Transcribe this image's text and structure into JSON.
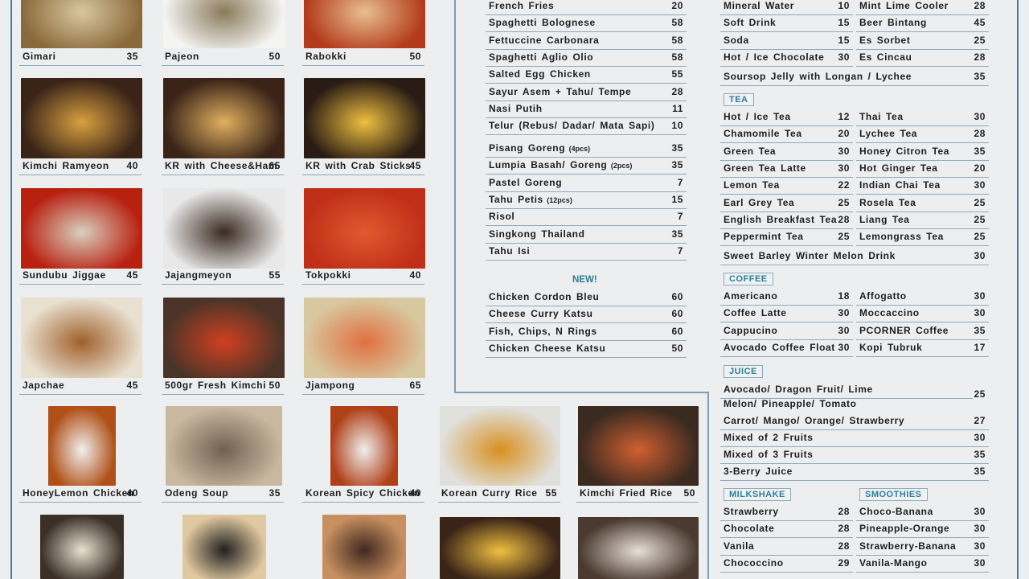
{
  "photo_items": [
    {
      "name": "Gimari",
      "price": "35"
    },
    {
      "name": "Pajeon",
      "price": "50"
    },
    {
      "name": "Rabokki",
      "price": "50"
    },
    {
      "name": "Kimchi Ramyeon",
      "price": "40"
    },
    {
      "name": "KR with Cheese&Ham",
      "price": "65"
    },
    {
      "name": "KR with Crab Sticks",
      "price": "45"
    },
    {
      "name": "Sundubu Jiggae",
      "price": "45"
    },
    {
      "name": "Jajangmeyon",
      "price": "55"
    },
    {
      "name": "Tokpokki",
      "price": "40"
    },
    {
      "name": "Japchae",
      "price": "45"
    },
    {
      "name": "500gr Fresh Kimchi",
      "price": "50"
    },
    {
      "name": "Jjampong",
      "price": "65"
    },
    {
      "name": "HoneyLemon Chicken",
      "price": "40"
    },
    {
      "name": "Odeng Soup",
      "price": "35"
    },
    {
      "name": "Korean Spicy Chicken",
      "price": "40"
    },
    {
      "name": "Korean Curry Rice",
      "price": "55"
    },
    {
      "name": "Kimchi Fried Rice",
      "price": "50"
    }
  ],
  "main_menu": [
    {
      "name": "French Fries",
      "price": "20"
    },
    {
      "name": "Spaghetti Bolognese",
      "price": "58"
    },
    {
      "name": "Fettuccine Carbonara",
      "price": "58"
    },
    {
      "name": "Spaghetti Aglio Olio",
      "price": "58"
    },
    {
      "name": "Salted Egg Chicken",
      "price": "55"
    },
    {
      "name": "Sayur Asem + Tahu/ Tempe",
      "price": "28"
    },
    {
      "name": "Nasi Putih",
      "price": "11"
    },
    {
      "name": "Telur (Rebus/ Dadar/ Mata Sapi)",
      "price": "10"
    }
  ],
  "snacks": [
    {
      "name": "Pisang Goreng",
      "note": "(4pcs)",
      "price": "35"
    },
    {
      "name": "Lumpia Basah/ Goreng",
      "note": "(2pcs)",
      "price": "35"
    },
    {
      "name": "Pastel Goreng",
      "price": "7"
    },
    {
      "name": "Tahu Petis",
      "note": "(12pcs)",
      "price": "15"
    },
    {
      "name": "Risol",
      "price": "7"
    },
    {
      "name": "Singkong Thailand",
      "price": "35"
    },
    {
      "name": "Tahu Isi",
      "price": "7"
    }
  ],
  "new_section": {
    "label": "NEW!",
    "items": [
      {
        "name": "Chicken Cordon Bleu",
        "price": "60"
      },
      {
        "name": "Cheese Curry Katsu",
        "price": "60"
      },
      {
        "name": "Fish, Chips, N Rings",
        "price": "60"
      },
      {
        "name": "Chicken Cheese Katsu",
        "price": "50"
      }
    ]
  },
  "drinks": {
    "left": [
      {
        "name": "Mineral Water",
        "price": "10"
      },
      {
        "name": "Soft Drink",
        "price": "15"
      },
      {
        "name": "Soda",
        "price": "15"
      },
      {
        "name": "Hot / Ice Chocolate",
        "price": "30"
      }
    ],
    "right": [
      {
        "name": "Mint Lime Cooler",
        "price": "28"
      },
      {
        "name": "Beer Bintang",
        "price": "45"
      },
      {
        "name": "Es Sorbet",
        "price": "25"
      },
      {
        "name": "Es Cincau",
        "price": "28"
      }
    ],
    "wide": {
      "name": "Soursop Jelly with Longan / Lychee",
      "price": "35"
    }
  },
  "tea": {
    "label": "TEA",
    "left": [
      {
        "name": "Hot / Ice Tea",
        "price": "12"
      },
      {
        "name": "Chamomile Tea",
        "price": "20"
      },
      {
        "name": "Green Tea",
        "price": "30"
      },
      {
        "name": "Green Tea Latte",
        "price": "30"
      },
      {
        "name": "Lemon Tea",
        "price": "22"
      },
      {
        "name": "Earl Grey Tea",
        "price": "25"
      },
      {
        "name": "English Breakfast Tea",
        "price": "28"
      },
      {
        "name": "Peppermint Tea",
        "price": "25"
      }
    ],
    "right": [
      {
        "name": "Thai Tea",
        "price": "30"
      },
      {
        "name": "Lychee Tea",
        "price": "28"
      },
      {
        "name": "Honey Citron Tea",
        "price": "35"
      },
      {
        "name": "Hot Ginger Tea",
        "price": "20"
      },
      {
        "name": "Indian Chai Tea",
        "price": "30"
      },
      {
        "name": "Rosela Tea",
        "price": "25"
      },
      {
        "name": "Liang Tea",
        "price": "25"
      },
      {
        "name": "Lemongrass Tea",
        "price": "25"
      }
    ],
    "wide": {
      "name": "Sweet Barley Winter Melon Drink",
      "price": "30"
    }
  },
  "coffee": {
    "label": "COFFEE",
    "left": [
      {
        "name": "Americano",
        "price": "18"
      },
      {
        "name": "Coffee Latte",
        "price": "30"
      },
      {
        "name": "Cappucino",
        "price": "30"
      },
      {
        "name": "Avocado Coffee Float",
        "price": "30"
      }
    ],
    "right": [
      {
        "name": "Affogatto",
        "price": "30"
      },
      {
        "name": "Moccaccino",
        "price": "30"
      },
      {
        "name": "PCORNER Coffee",
        "price": "35"
      },
      {
        "name": "Kopi Tubruk",
        "price": "17"
      }
    ]
  },
  "juice": {
    "label": "JUICE",
    "first": {
      "line1": "Avocado/ Dragon Fruit/ Lime",
      "line2": "Melon/ Pineapple/ Tomato",
      "price": "25"
    },
    "items": [
      {
        "name": "Carrot/ Mango/ Orange/ Strawberry",
        "price": "27"
      },
      {
        "name": "Mixed of 2 Fruits",
        "price": "30"
      },
      {
        "name": "Mixed of 3 Fruits",
        "price": "35"
      },
      {
        "name": "3-Berry Juice",
        "price": "35"
      }
    ]
  },
  "milkshake": {
    "label": "MILKSHAKE",
    "items": [
      {
        "name": "Strawberry",
        "price": "28"
      },
      {
        "name": "Chocolate",
        "price": "28"
      },
      {
        "name": "Vanila",
        "price": "28"
      },
      {
        "name": "Chococcino",
        "price": "29"
      }
    ]
  },
  "smoothies": {
    "label": "SMOOTHIES",
    "items": [
      {
        "name": "Choco-Banana",
        "price": "30"
      },
      {
        "name": "Pineapple-Orange",
        "price": "30"
      },
      {
        "name": "Strawberry-Banana",
        "price": "30"
      },
      {
        "name": "Vanila-Mango",
        "price": "30"
      }
    ]
  },
  "colors": {
    "accent": "#3f7fa3",
    "rule": "#8eaabb",
    "section_label": "#2f7d96",
    "background": "#eceef0"
  }
}
